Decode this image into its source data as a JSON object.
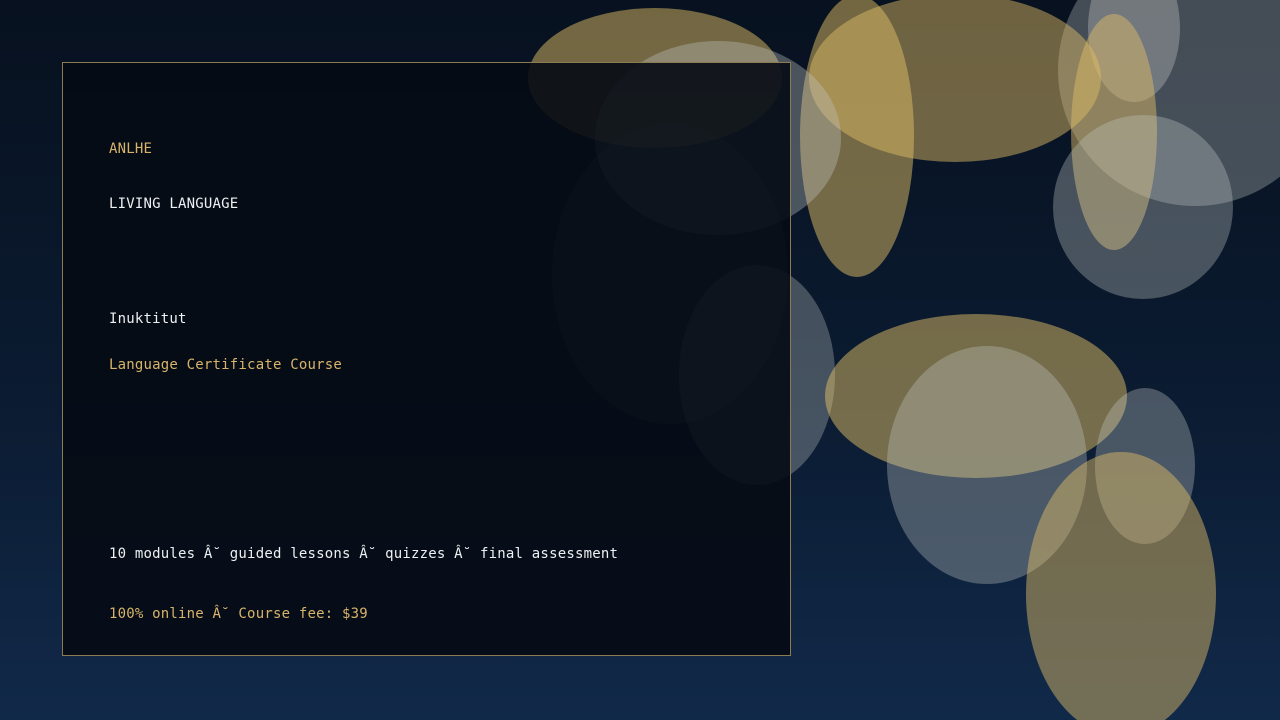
{
  "brand": "ANLHE",
  "tagline": "LIVING LANGUAGE",
  "language": "Inuktitut",
  "course_title": "Language Certificate Course",
  "features": "10 modules Â˘ guided lessons Â˘ quizzes Â˘ final assessment",
  "pricing": "100% online Â˘ Course fee: $39",
  "colors": {
    "background_top": "#07111f",
    "background_bottom": "#112949",
    "accent_gold": "#d8b46a",
    "text_white": "#eef0f2",
    "panel_border": "#8d7b52",
    "bokeh_gold": "#e2bf67",
    "bokeh_gray": "#c2c6c4"
  }
}
